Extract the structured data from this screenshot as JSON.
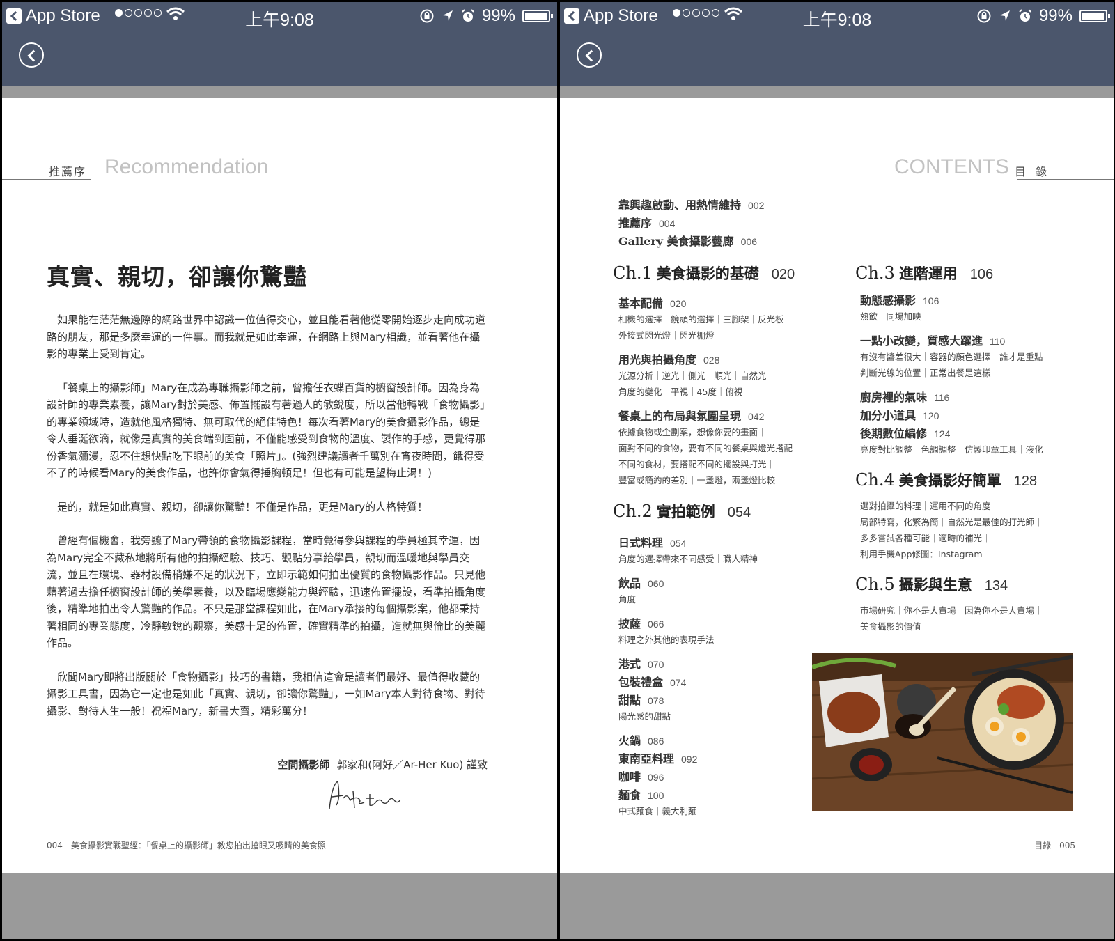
{
  "status_bar": {
    "back_app": "App Store",
    "time": "上午9:08",
    "battery": "99%"
  },
  "left_page": {
    "heading_zh": "推薦序",
    "heading_en": "Recommendation",
    "title": "真實、親切，卻讓你驚豔",
    "paragraphs": [
      "如果能在茫茫無邊際的網路世界中認識一位值得交心，並且能看著他從零開始逐步走向成功道路的朋友，那是多麼幸運的一件事。而我就是如此幸運，在網路上與Mary相識，並看著他在攝影的專業上受到肯定。",
      "「餐桌上的攝影師」Mary在成為專職攝影師之前，曾擔任衣蝶百貨的櫥窗設計師。因為身為設計師的專業素養，讓Mary對於美感、佈置擺設有著過人的敏銳度，所以當他轉戰「食物攝影」的專業領域時，造就他風格獨特、無可取代的絕佳特色！每次看著Mary的美食攝影作品，總是令人垂涎欲滴，就像是真實的美食端到面前，不僅能感受到食物的溫度、製作的手感，更覺得那份香氣瀰漫，忍不住想快點吃下眼前的美食「照片」。(強烈建議讀者千萬別在宵夜時間，餓得受不了的時候看Mary的美食作品，也許你會氣得捶胸頓足！但也有可能是望梅止渴！)",
      "是的，就是如此真實、親切，卻讓你驚豔！不僅是作品，更是Mary的人格特質！",
      "曾經有個機會，我旁聽了Mary帶領的食物攝影課程，當時覺得參與課程的學員極其幸運，因為Mary完全不藏私地將所有他的拍攝經驗、技巧、觀點分享給學員，親切而溫暖地與學員交流，並且在環境、器材設備稍嫌不足的狀況下，立即示範如何拍出優質的食物攝影作品。只見他藉著過去擔任櫥窗設計師的美學素養，以及臨場應變能力與經驗，迅速佈置擺設，看準拍攝角度後，精準地拍出令人驚豔的作品。不只是那堂課程如此，在Mary承接的每個攝影案，他都秉持著相同的專業態度，冷靜敏銳的觀察，美感十足的佈置，確實精準的拍攝，造就無與倫比的美麗作品。",
      "欣聞Mary即將出版關於「食物攝影」技巧的書籍，我相信這會是讀者們最好、最值得收藏的攝影工具書，因為它一定也是如此「真實、親切，卻讓你驚豔」，一如Mary本人對待食物、對待攝影、對待人生一般！祝福Mary，新書大賣，精彩萬分！"
    ],
    "sign_role": "空間攝影師",
    "sign_name": "郭家和(阿好／Ar-Her Kuo) 謹致",
    "signature_text": "Ar-Her Kuo",
    "footer": "004　美食攝影實戰聖經：「餐桌上的攝影師」教您拍出搶眼又吸睛的美食照"
  },
  "right_page": {
    "heading_en": "CONTENTS",
    "heading_zh": "目錄",
    "intro": [
      {
        "title": "靠興趣啟動、用熱情維持",
        "page": "002"
      },
      {
        "title": "推薦序",
        "page": "004"
      },
      {
        "title": "Gallery 美食攝影藝廊",
        "page": "006"
      }
    ],
    "chapters": [
      {
        "label": "Ch.1",
        "title": "美食攝影的基礎",
        "page": "020"
      },
      {
        "label": "Ch.2",
        "title": "實拍範例",
        "page": "054"
      },
      {
        "label": "Ch.3",
        "title": "進階運用",
        "page": "106"
      },
      {
        "label": "Ch.4",
        "title": "美食攝影好簡單",
        "page": "128"
      },
      {
        "label": "Ch.5",
        "title": "攝影與生意",
        "page": "134"
      }
    ],
    "ch1_items": [
      {
        "title": "基本配備",
        "page": "020"
      },
      {
        "title": "用光與拍攝角度",
        "page": "028"
      },
      {
        "title": "餐桌上的布局與氛圍呈現",
        "page": "042"
      }
    ],
    "ch1_subs": [
      "相機的選擇｜鏡頭的選擇｜三腳架｜反光板｜",
      "外接式閃光燈｜閃光棚燈",
      "光源分析｜逆光｜側光｜順光｜自然光",
      "角度的變化｜平視｜45度｜俯視",
      "依據食物或企劃案，想像你要的畫面｜",
      "面對不同的食物，要有不同的餐桌與燈光搭配｜",
      "不同的食材，要搭配不同的擺設與打光｜",
      "豐富或簡約的差別｜一盞燈，兩盞燈比較"
    ],
    "ch2_items": [
      {
        "title": "日式料理",
        "page": "054"
      },
      {
        "title": "飲品",
        "page": "060"
      },
      {
        "title": "披薩",
        "page": "066"
      },
      {
        "title": "港式",
        "page": "070"
      },
      {
        "title": "包裝禮盒",
        "page": "074"
      },
      {
        "title": "甜點",
        "page": "078"
      },
      {
        "title": "火鍋",
        "page": "086"
      },
      {
        "title": "東南亞料理",
        "page": "092"
      },
      {
        "title": "咖啡",
        "page": "096"
      },
      {
        "title": "麵食",
        "page": "100"
      }
    ],
    "ch2_subs": [
      "角度的選擇帶來不同感受｜職人精神",
      "角度",
      "料理之外其他的表現手法",
      "陽光感的甜點",
      "中式麵食｜義大利麵"
    ],
    "ch3_items": [
      {
        "title": "動態感攝影",
        "page": "106"
      },
      {
        "title": "一點小改變，質感大躍進",
        "page": "110"
      },
      {
        "title": "廚房裡的氣味",
        "page": "116"
      },
      {
        "title": "加分小道具",
        "page": "120"
      },
      {
        "title": "後期數位編修",
        "page": "124"
      }
    ],
    "ch3_subs": [
      "熱飲｜同場加映",
      "有沒有醬差很大｜容器的顏色選擇｜誰才是重點｜",
      "判斷光線的位置｜正常出餐是這樣",
      "亮度對比調整｜色調調整｜仿製印章工具｜液化"
    ],
    "ch4_subs": [
      "選對拍攝的料理｜運用不同的角度｜",
      "局部特寫，化繁為簡｜自然光是最佳的打光師｜",
      "多多嘗試各種可能｜適時的補光｜",
      "利用手機App修圖：Instagram"
    ],
    "ch5_subs": [
      "市場研究｜你不是大賣場｜因為你不是大賣場｜",
      "美食攝影的價值"
    ],
    "footer": "目錄　005"
  }
}
